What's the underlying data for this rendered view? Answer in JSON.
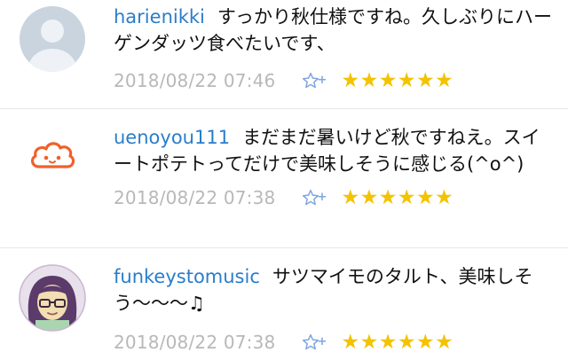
{
  "comments": [
    {
      "user": "harienikki",
      "text": "すっかり秋仕様ですね。久しぶりにハーゲンダッツ食べたいです、",
      "timestamp": "2018/08/22 07:46",
      "stars": "★★★★★★",
      "add_star": "+"
    },
    {
      "user": "uenoyou111",
      "text": "まだまだ暑いけど秋ですねえ。スイートポテトってだけで美味しそうに感じる(^o^)",
      "timestamp": "2018/08/22 07:38",
      "stars": "★★★★★★",
      "add_star": "+"
    },
    {
      "user": "funkeystomusic",
      "text": "サツマイモのタルト、美味しそう〜〜〜♫",
      "timestamp": "2018/08/22 07:38",
      "stars": "★★★★★★",
      "add_star": "+"
    }
  ],
  "colors": {
    "username": "#2a7dcb",
    "timestamp": "#b8b8b8",
    "star": "#f3c300",
    "add_star": "#7fa6e0",
    "avatar_cloud": "#f0612b"
  }
}
